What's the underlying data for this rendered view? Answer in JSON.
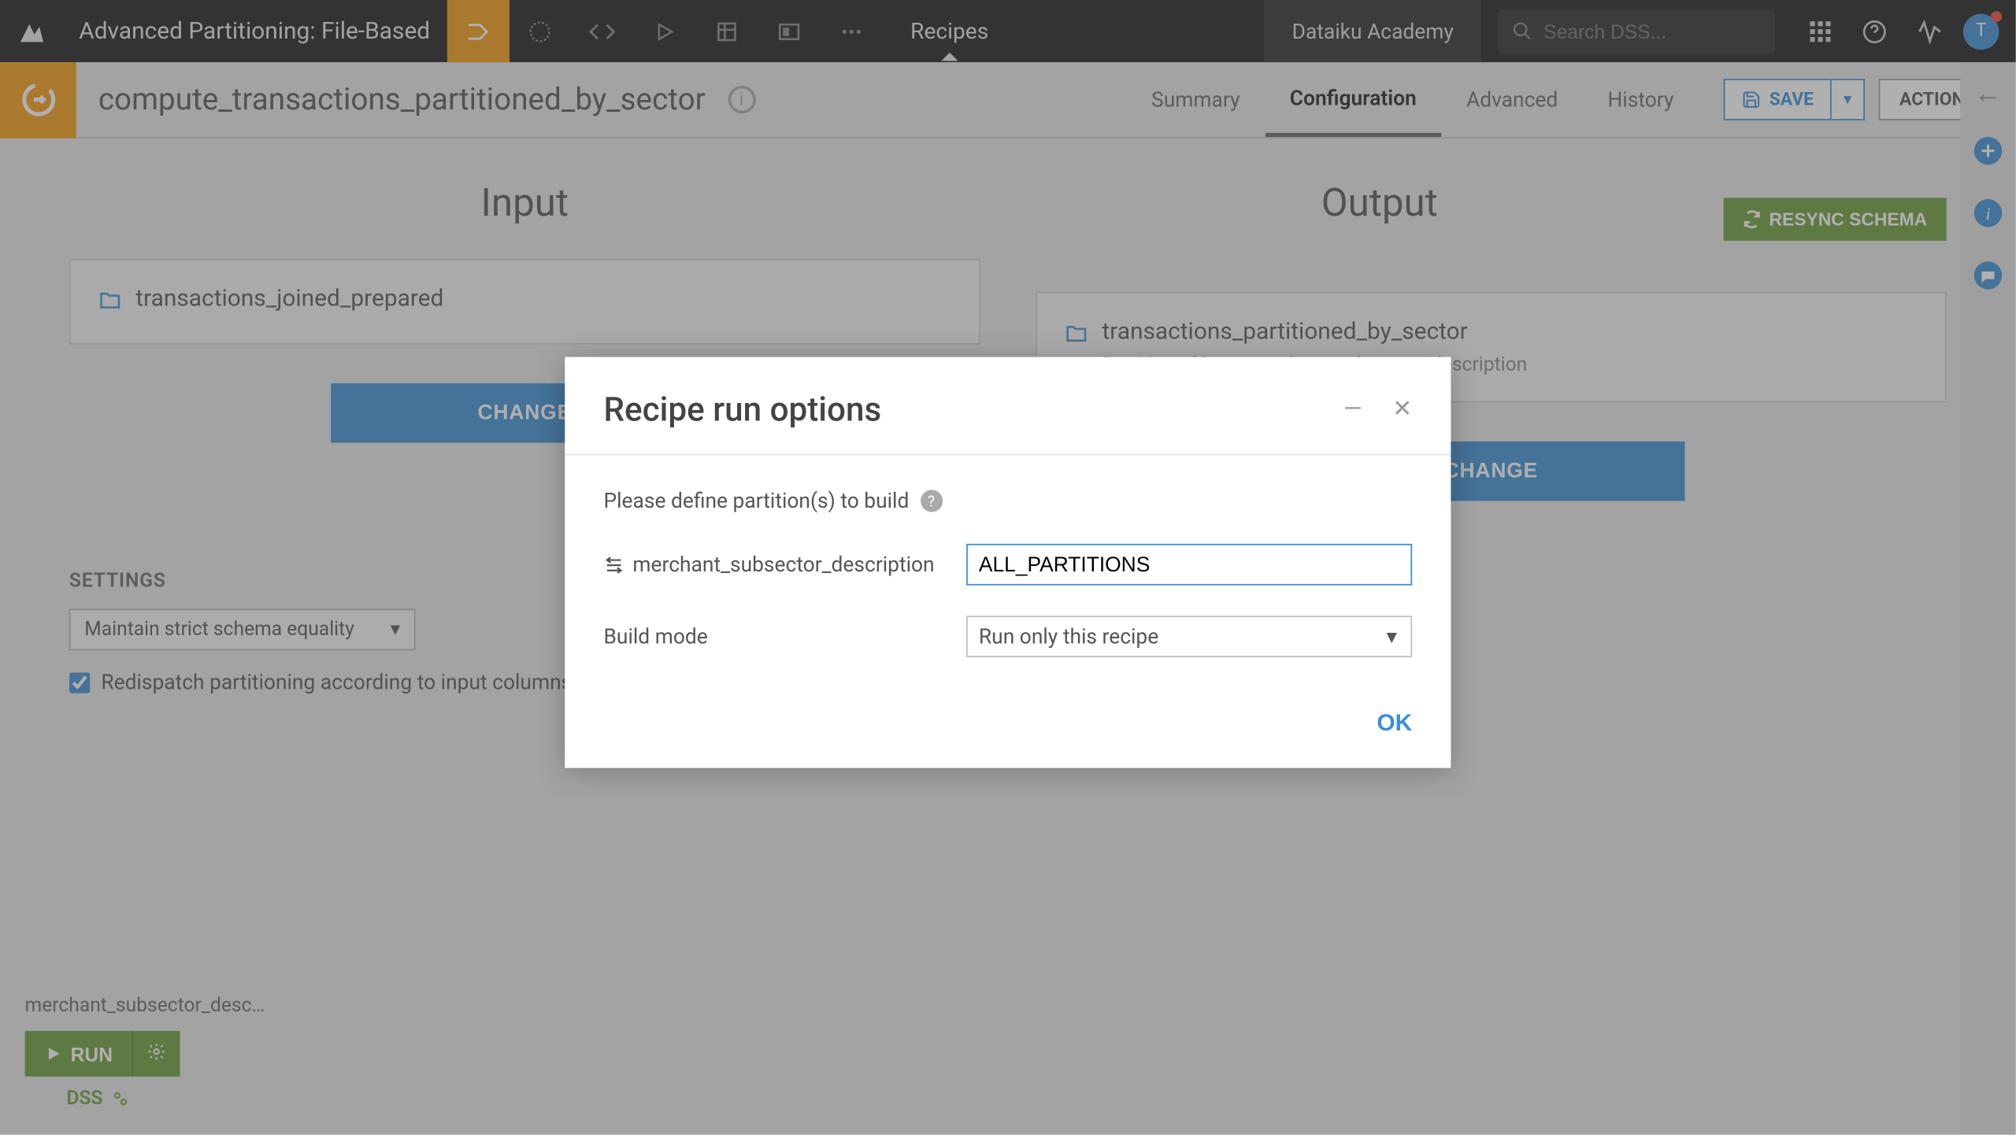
{
  "topbar": {
    "project_name": "Advanced Partitioning: File-Based",
    "recipes_label": "Recipes",
    "academy_label": "Dataiku Academy",
    "search_placeholder": "Search DSS...",
    "avatar_initial": "T"
  },
  "recipe": {
    "title": "compute_transactions_partitioned_by_sector",
    "tabs": {
      "summary": "Summary",
      "configuration": "Configuration",
      "advanced": "Advanced",
      "history": "History"
    },
    "save_label": "SAVE",
    "actions_label": "ACTIONS"
  },
  "io": {
    "input_heading": "Input",
    "output_heading": "Output",
    "resync_label": "RESYNC SCHEMA",
    "input_dataset": "transactions_joined_prepared",
    "output_dataset": "transactions_partitioned_by_sector",
    "output_partitioned_by_label": "Partitioned by:",
    "output_partitioned_by_value": "merchant_subsector_description",
    "change_label": "CHANGE"
  },
  "settings": {
    "heading": "SETTINGS",
    "schema_mode": "Maintain strict schema equality",
    "redispatch_label": "Redispatch partitioning according to input columns",
    "redispatch_checked": true
  },
  "bottom": {
    "columns_summary": "merchant_subsector_desc…",
    "run_label": "RUN",
    "engine_label": "DSS"
  },
  "modal": {
    "title": "Recipe run options",
    "prompt": "Please define partition(s) to build",
    "partition_dim_label": "merchant_subsector_description",
    "partition_value": "ALL_PARTITIONS",
    "build_mode_label": "Build mode",
    "build_mode_value": "Run only this recipe",
    "ok_label": "OK"
  }
}
